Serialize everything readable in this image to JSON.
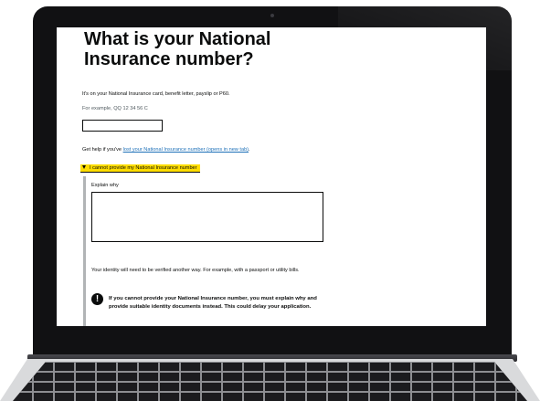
{
  "page": {
    "heading": "What is your National Insurance number?",
    "intro": "It's on your National Insurance card, benefit letter, payslip or P60.",
    "example_hint": "For example, QQ 12 34 56 C",
    "ni_input_value": "",
    "help_prefix": "Get help if you've ",
    "help_link": "lost your National Insurance number (opens in new tab)",
    "help_suffix": "."
  },
  "details": {
    "summary": "I cannot provide my National Insurance number",
    "expanded": true,
    "explain_label": "Explain why",
    "explain_value": "",
    "verify_text": "Your identity will need to be verified another way. For example, with a passport or utility bills.",
    "warning_icon_text": "!",
    "warning_text": "If you cannot provide your National Insurance number, you must explain why and provide suitable identity documents instead. This could delay your application."
  },
  "colors": {
    "link": "#1d70b8",
    "focus_yellow": "#ffdd00",
    "text": "#0b0c0c",
    "secondary_text": "#505a5f",
    "details_border": "#b1b4b6",
    "laptop_bezel": "#111113"
  },
  "icons": {
    "summary_icon": "triangle-down-icon",
    "warning_icon": "exclamation-circle-icon"
  }
}
